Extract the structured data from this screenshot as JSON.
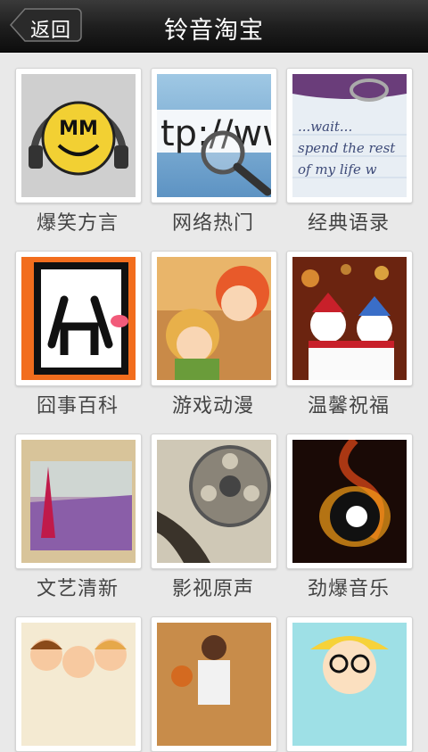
{
  "header": {
    "back_label": "返回",
    "title": "铃音淘宝"
  },
  "categories": [
    {
      "label": "爆笑方言",
      "logo_text": "MM"
    },
    {
      "label": "网络热门",
      "url_fragment": "tp://www"
    },
    {
      "label": "经典语录",
      "handwriting": [
        "...wait...",
        "spend the rest",
        "of my life w"
      ]
    },
    {
      "label": "囧事百科"
    },
    {
      "label": "游戏动漫"
    },
    {
      "label": "温馨祝福"
    },
    {
      "label": "文艺清新"
    },
    {
      "label": "影视原声"
    },
    {
      "label": "劲爆音乐"
    }
  ]
}
